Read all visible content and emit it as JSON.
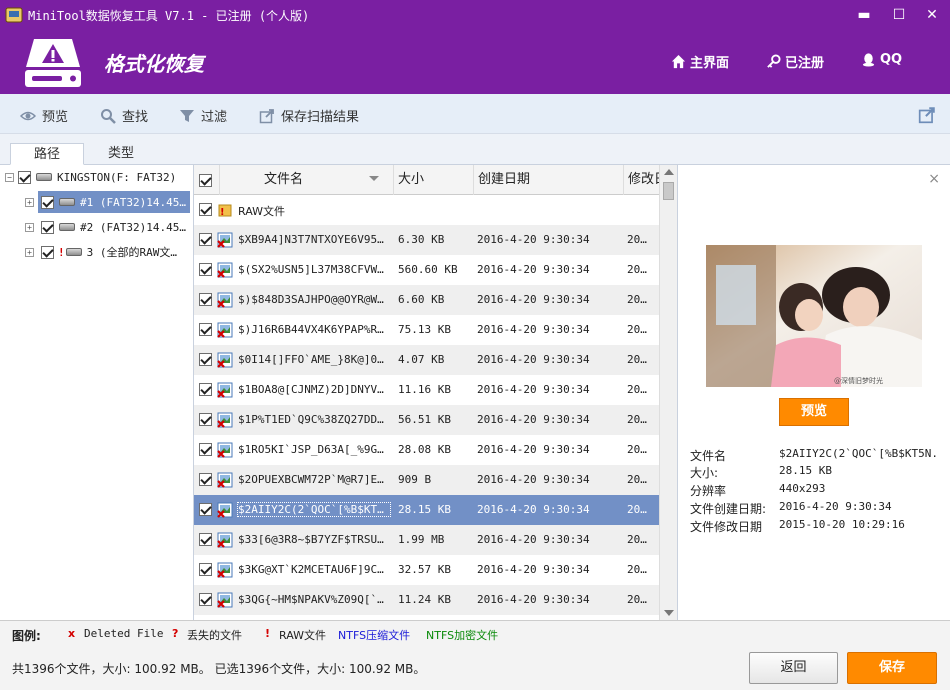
{
  "window": {
    "title": "MiniTool数据恢复工具 V7.1 - 已注册 (个人版)",
    "controls": {
      "minimize": "▬",
      "maximize": "☐",
      "close": "✕"
    }
  },
  "header": {
    "heading": "格式化恢复",
    "links": {
      "home": "主界面",
      "registered": "已注册",
      "qq": "QQ"
    }
  },
  "toolbar": {
    "preview": "预览",
    "find": "查找",
    "filter": "过滤",
    "save_scan": "保存扫描结果"
  },
  "tabs": {
    "path": "路径",
    "type": "类型"
  },
  "tree": {
    "root": "KINGSTON(F: FAT32)",
    "items": [
      "#1 (FAT32)14.45…",
      "#2 (FAT32)14.45…",
      "3 (全部的RAW文…"
    ]
  },
  "file_list": {
    "columns": {
      "name": "文件名",
      "size": "大小",
      "created": "创建日期",
      "modified": "修改日"
    },
    "raw_folder": "RAW文件",
    "rows": [
      {
        "name": "$XB9A4]N3T7NTXOYE6V95F2…",
        "size": "6.30 KB",
        "created": "2016-4-20 9:30:34",
        "modified": "20…"
      },
      {
        "name": "$(SX2%USN5]L37M38CFVWHM…",
        "size": "560.60 KB",
        "created": "2016-4-20 9:30:34",
        "modified": "20…"
      },
      {
        "name": "$)$848D3SAJHPO@@OYR@W3P…",
        "size": "6.60 KB",
        "created": "2016-4-20 9:30:34",
        "modified": "20…"
      },
      {
        "name": "$)J16R6B44VX4K6YPAP%R[R…",
        "size": "75.13 KB",
        "created": "2016-4-20 9:30:34",
        "modified": "20…"
      },
      {
        "name": "$0I14[]FFO`AME_}8K@]0]I…",
        "size": "4.07 KB",
        "created": "2016-4-20 9:30:34",
        "modified": "20…"
      },
      {
        "name": "$1BOA8@[CJNMZ)2D]DNYV]G…",
        "size": "11.16 KB",
        "created": "2016-4-20 9:30:34",
        "modified": "20…"
      },
      {
        "name": "$1P%T1ED`Q9C%38ZQ27DD9A…",
        "size": "56.51 KB",
        "created": "2016-4-20 9:30:34",
        "modified": "20…"
      },
      {
        "name": "$1RO5KI`JSP_D63A[_%9GXS…",
        "size": "28.08 KB",
        "created": "2016-4-20 9:30:34",
        "modified": "20…"
      },
      {
        "name": "$2OPUEXBCWM72P`M@R7]E)7…",
        "size": "909 B",
        "created": "2016-4-20 9:30:34",
        "modified": "20…"
      },
      {
        "name": "$2AIIY2C(2`QOC`[%B$KT5N…",
        "size": "28.15 KB",
        "created": "2016-4-20 9:30:34",
        "modified": "20…"
      },
      {
        "name": "$33[6@3R8~$B7YZF$TRSU5E…",
        "size": "1.99 MB",
        "created": "2016-4-20 9:30:34",
        "modified": "20…"
      },
      {
        "name": "$3KG@XT`K2MCETAU6F]9C_9…",
        "size": "32.57 KB",
        "created": "2016-4-20 9:30:34",
        "modified": "20…"
      },
      {
        "name": "$3QG{~HM$NPAKV%Z09Q[`9…",
        "size": "11.24 KB",
        "created": "2016-4-20 9:30:34",
        "modified": "20…"
      }
    ]
  },
  "preview": {
    "close": "×",
    "photo_watermark": "@深情旧梦时光",
    "button": "预览",
    "info": {
      "name_label": "文件名",
      "name": "$2AIIY2C(2`QOC`[%B$KT5N.jpg",
      "size_label": "大小:",
      "size": "28.15 KB",
      "res_label": "分辨率",
      "res": "440x293",
      "created_label": "文件创建日期:",
      "created": "2016-4-20 9:30:34",
      "modified_label": "文件修改日期",
      "modified": "2015-10-20 10:29:16"
    }
  },
  "legend": {
    "title": "图例:",
    "deleted_mark": "x",
    "deleted": "Deleted File",
    "lost_mark": "?",
    "lost": "丢失的文件",
    "raw_mark": "!",
    "raw": "RAW文件",
    "ntfs_compressed": "NTFS压缩文件",
    "ntfs_encrypted": "NTFS加密文件",
    "colors": {
      "deleted": "#d40000",
      "compressed": "#1a1ad8",
      "encrypted": "#0a8a0a"
    }
  },
  "status": {
    "text": "共1396个文件，大小: 100.92 MB。 已选1396个文件，大小: 100.92 MB。",
    "back": "返回",
    "save": "保存"
  }
}
